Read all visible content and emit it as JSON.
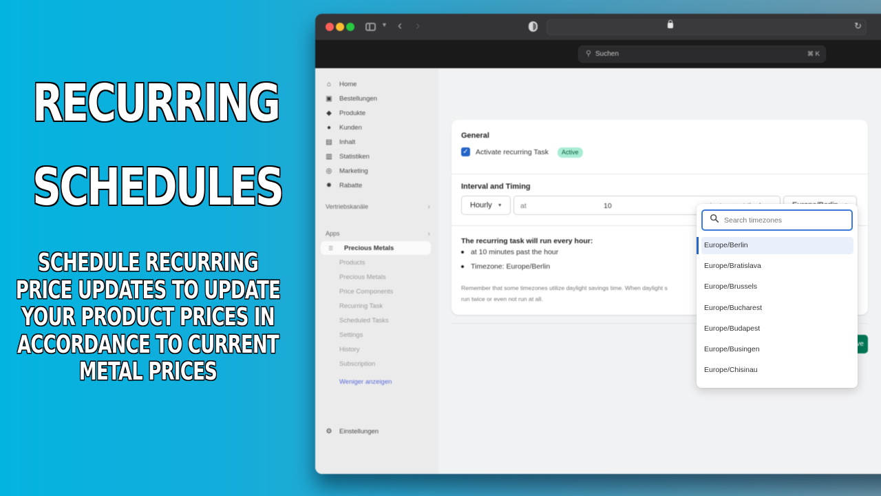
{
  "promo": {
    "title_line1": "RECURRING",
    "title_line2": "SCHEDULES",
    "subtitle_lines": [
      "SCHEDULE RECURRING",
      "PRICE UPDATES TO UPDATE",
      "YOUR PRODUCT PRICES IN",
      "ACCORDANCE TO CURRENT",
      "METAL PRICES"
    ]
  },
  "browser": {
    "search_placeholder": "Suchen",
    "search_shortcut": "⌘ K",
    "icons": [
      "sidebar-toggle-icon",
      "back-icon",
      "forward-icon",
      "shield-icon",
      "lock-icon",
      "reload-icon"
    ]
  },
  "sidebar": {
    "items": [
      {
        "label": "Home",
        "icon": "⌂"
      },
      {
        "label": "Bestellungen",
        "icon": "▣"
      },
      {
        "label": "Produkte",
        "icon": "◆"
      },
      {
        "label": "Kunden",
        "icon": "●"
      },
      {
        "label": "Inhalt",
        "icon": "▤"
      },
      {
        "label": "Statistiken",
        "icon": "▥"
      },
      {
        "label": "Marketing",
        "icon": "◎"
      },
      {
        "label": "Rabatte",
        "icon": "✹"
      }
    ],
    "sales_channels_label": "Vertriebskanäle",
    "apps_label": "Apps",
    "active_app": "Precious Metals",
    "app_subitems": [
      "Products",
      "Precious Metals",
      "Price Components",
      "Recurring Task",
      "Scheduled Tasks",
      "Settings",
      "History",
      "Subscription"
    ],
    "show_less": "Weniger anzeigen",
    "settings_label": "Einstellungen"
  },
  "form": {
    "general_heading": "General",
    "activate_label": "Activate recurring Task",
    "activate_checked": true,
    "status_badge": "Active",
    "interval_heading": "Interval and Timing",
    "interval_value": "Hourly",
    "at_prefix": "at",
    "minute_value": "10",
    "at_suffix": "minutes past the hour",
    "timezone_value": "Europe/Berlin",
    "summary_title": "The recurring task will run every hour:",
    "summary_items": [
      "at 10 minutes past the hour",
      "Timezone: Europe/Berlin"
    ],
    "note": "Remember that some timezones utilize daylight savings time. When daylight s... run twice or even not run at all.",
    "note_line1": "Remember that some timezones utilize daylight savings time. When daylight s",
    "note_line2": "run twice or even not run at all.",
    "save_label": "Save"
  },
  "timezone_dropdown": {
    "search_placeholder": "Search timezones",
    "selected": "Europe/Berlin",
    "options": [
      "Europe/Berlin",
      "Europe/Bratislava",
      "Europe/Brussels",
      "Europe/Bucharest",
      "Europe/Budapest",
      "Europe/Busingen",
      "Europe/Chisinau"
    ]
  },
  "colors": {
    "primary_blue": "#2463c7",
    "active_badge_bg": "#a8ecd4",
    "save_green": "#047857",
    "background_cyan": "#04b4e0"
  }
}
